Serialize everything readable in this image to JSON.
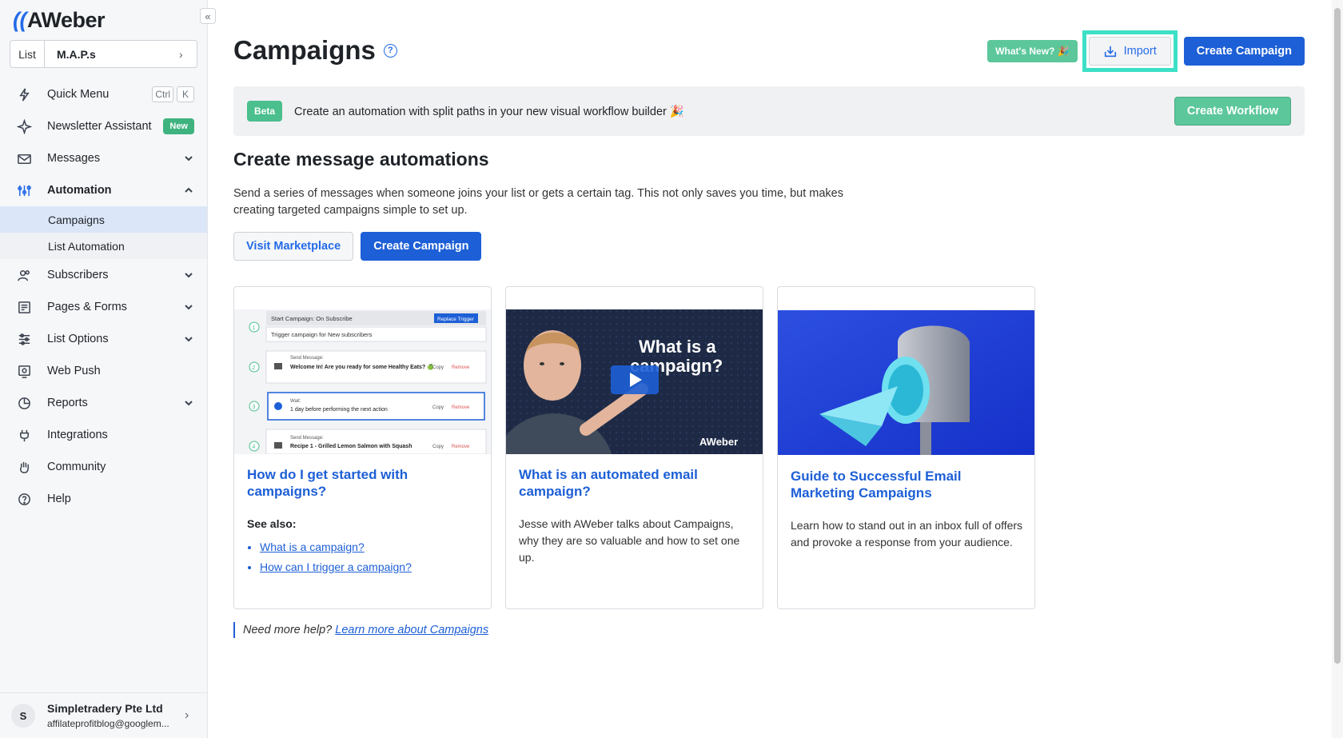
{
  "app": {
    "logo_text": "AWeber",
    "logo_mark": "(("
  },
  "sidebar": {
    "collapse_label": "«",
    "list_selector": {
      "label": "List",
      "value": "M.A.P.s",
      "chevron": "›"
    },
    "items": [
      {
        "label": "Quick Menu",
        "icon": "lightning-icon",
        "kbd": [
          "Ctrl",
          "K"
        ]
      },
      {
        "label": "Newsletter Assistant",
        "icon": "sparkle-icon",
        "badge": "New"
      },
      {
        "label": "Messages",
        "icon": "envelope-icon"
      },
      {
        "label": "Automation",
        "icon": "automation-icon"
      },
      {
        "label": "Subscribers",
        "icon": "users-icon"
      },
      {
        "label": "Pages & Forms",
        "icon": "form-icon"
      },
      {
        "label": "List Options",
        "icon": "sliders-icon"
      },
      {
        "label": "Web Push",
        "icon": "web-push-icon"
      },
      {
        "label": "Reports",
        "icon": "pie-chart-icon"
      },
      {
        "label": "Integrations",
        "icon": "plug-icon"
      },
      {
        "label": "Community",
        "icon": "hand-icon"
      },
      {
        "label": "Help",
        "icon": "help-circle-icon"
      }
    ],
    "automation_sub": [
      {
        "label": "Campaigns"
      },
      {
        "label": "List Automation"
      }
    ],
    "account": {
      "initial": "S",
      "name": "Simpletradery Pte Ltd",
      "email": "affilateprofitblog@googlem..."
    }
  },
  "header": {
    "title": "Campaigns",
    "help_glyph": "?",
    "whats_new_label": "What's New? 🎉",
    "import_label": "Import",
    "create_campaign_label": "Create Campaign"
  },
  "beta": {
    "tag": "Beta",
    "text": "Create an automation with split paths in your new visual workflow builder 🎉",
    "button_label": "Create Workflow"
  },
  "section": {
    "title": "Create message automations",
    "description": "Send a series of messages when someone joins your list or gets a certain tag. This not only saves you time, but makes creating targeted campaigns simple to set up.",
    "visit_marketplace_label": "Visit Marketplace",
    "create_campaign_label": "Create Campaign"
  },
  "cards": [
    {
      "title": "How do I get started with campaigns?",
      "see_also": "See also:",
      "links": [
        "What is a campaign?",
        "How can I trigger a campaign?"
      ],
      "thumb": {
        "start_label": "Start Campaign: On Subscribe",
        "replace_label": "Replace Trigger",
        "trigger_text": "Trigger campaign for New subscribers",
        "steps": [
          {
            "num": "2",
            "kind": "Send Message:",
            "text": "Welcome In! Are you ready for some Healthy Eats? 🍏"
          },
          {
            "num": "3",
            "kind": "Wait:",
            "text": "1 day before performing the next action"
          },
          {
            "num": "4",
            "kind": "Send Message:",
            "text": "Recipe 1 - Grilled Lemon Salmon with Squash"
          }
        ],
        "step1_num": "1",
        "copy_label": "Copy",
        "remove_label": "Remove"
      }
    },
    {
      "title": "What is an automated email campaign?",
      "body": "Jesse with AWeber talks about Campaigns, why they are so valuable and how to set one up.",
      "video_text_1": "What is a",
      "video_text_2": "campaign?",
      "video_brand": "AWeber"
    },
    {
      "title": "Guide to Successful Email Marketing Campaigns",
      "body": "Learn how to stand out in an inbox full of offers and provoke a response from your audience."
    }
  ],
  "footer_help": {
    "prefix": "Need more help?",
    "link": "Learn more about Campaigns"
  },
  "colors": {
    "primary": "#1d5fd6",
    "green": "#5cc79b",
    "highlight": "#3de0c6"
  }
}
